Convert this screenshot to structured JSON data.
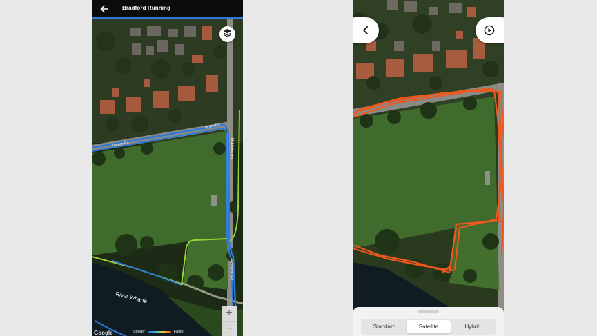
{
  "left_screen": {
    "header": {
      "title": "Bradford Running",
      "back_icon": "arrow-left-icon"
    },
    "layers_icon": "layers-icon",
    "map_labels": {
      "road_top": "Denton Rd",
      "road_left": "Denton Rd",
      "road_side_upper": "Middleton Ave",
      "road_side_lower": "Middleton Ave",
      "river": "River Wharfe"
    },
    "zoom": {
      "in": "+",
      "out": "−"
    },
    "legend": {
      "slower": "Slower",
      "faster": "Faster"
    },
    "attribution": "Google"
  },
  "right_screen": {
    "back_icon": "chevron-left-icon",
    "play_icon": "play-circle-icon",
    "map_type_options": [
      "Standard",
      "Satellite",
      "Hybrid"
    ],
    "selected_map_type": "Satellite"
  },
  "colors": {
    "route_blue": "#2f7ad8",
    "route_green": "#9ad13a",
    "route_orange": "#f0571f",
    "grass": "#3f6b2c",
    "river": "#0f1d22"
  }
}
